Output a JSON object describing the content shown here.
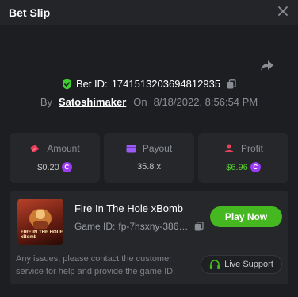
{
  "header": {
    "title": "Bet Slip"
  },
  "bet": {
    "id_label": "Bet ID:",
    "id_value": "174151320369481293​5",
    "by_label": "By",
    "user": "Satoshimaker",
    "on_label": "On",
    "datetime": "8/18/2022, 8:56:54 PM"
  },
  "stats": {
    "amount": {
      "label": "Amount",
      "value": "$0.20",
      "icon": "cash-icon"
    },
    "payout": {
      "label": "Payout",
      "value": "35.8 x",
      "icon": "wallet-icon"
    },
    "profit": {
      "label": "Profit",
      "value": "$6.96",
      "icon": "profit-icon"
    }
  },
  "game": {
    "title": "Fire In The Hole xBomb",
    "id_label": "Game ID:",
    "id_value": "fp-7hsxny-3867...",
    "thumb_text": "FIRE IN THE HOLE xBomb",
    "play_label": "Play Now"
  },
  "support": {
    "notice": "Any issues, please contact the customer service for help and provide the game ID.",
    "button_label": "Live Support"
  },
  "colors": {
    "accent_green": "#45b720",
    "profit_green": "#57d12d",
    "coin_purple": "#9b3bf2",
    "shield_green": "#3fcf2f"
  }
}
